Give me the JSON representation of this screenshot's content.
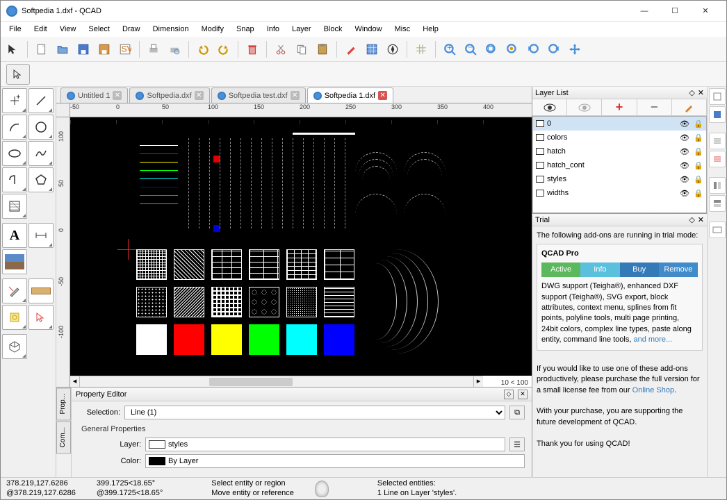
{
  "title": "Softpedia 1.dxf - QCAD",
  "window_buttons": {
    "minimize": "—",
    "maximize": "☐",
    "close": "✕"
  },
  "menu": [
    "File",
    "Edit",
    "View",
    "Select",
    "Draw",
    "Dimension",
    "Modify",
    "Snap",
    "Info",
    "Layer",
    "Block",
    "Window",
    "Misc",
    "Help"
  ],
  "tabs": [
    {
      "label": "Untitled 1",
      "active": false,
      "close": "gray"
    },
    {
      "label": "Softpedia.dxf",
      "active": false,
      "close": "gray"
    },
    {
      "label": "Softpedia test.dxf",
      "active": false,
      "close": "gray"
    },
    {
      "label": "Softpedia 1.dxf",
      "active": true,
      "close": "red"
    }
  ],
  "ruler_h": [
    "-50",
    "0",
    "50",
    "100",
    "150",
    "200",
    "250",
    "300",
    "350",
    "400"
  ],
  "ruler_v": [
    "100",
    "50",
    "0",
    "-50",
    "-100"
  ],
  "scroll_info": "10 < 100",
  "layer_panel": {
    "title": "Layer List",
    "layers": [
      {
        "name": "0",
        "selected": true
      },
      {
        "name": "colors",
        "selected": false
      },
      {
        "name": "hatch",
        "selected": false
      },
      {
        "name": "hatch_cont",
        "selected": false
      },
      {
        "name": "styles",
        "selected": false
      },
      {
        "name": "widths",
        "selected": false
      }
    ]
  },
  "trial": {
    "title": "Trial",
    "intro": "The following add-ons are running in trial mode:",
    "addon_name": "QCAD Pro",
    "btns": {
      "active": "Active",
      "info": "Info",
      "buy": "Buy",
      "remove": "Remove"
    },
    "desc": "DWG support (Teigha®), enhanced DXF support (Teigha®), SVG export, block attributes, context menu, splines from fit points, polyline tools, multi page printing, 24bit colors, complex line types, paste along entity, command line tools, ",
    "more": "and more...",
    "msg1a": "If you would like to use one of these add-ons productively, please purchase the full version for a small license fee from our ",
    "msg1b": "Online Shop",
    "msg1c": ".",
    "msg2": "With your purchase, you are supporting the future development of QCAD.",
    "msg3": "Thank you for using QCAD!"
  },
  "property_editor": {
    "title": "Property Editor",
    "selection_label": "Selection:",
    "selection_value": "Line (1)",
    "section": "General Properties",
    "layer_label": "Layer:",
    "layer_value": "styles",
    "color_label": "Color:",
    "color_value": "By Layer"
  },
  "vtabs": [
    "Prop...",
    "Com..."
  ],
  "status": {
    "coord1": "378.219,127.6286",
    "coord2": "@378.219,127.6286",
    "polar1": "399.1725<18.65°",
    "polar2": "@399.1725<18.65°",
    "hint1": "Select entity or region",
    "hint2": "Move entity or reference",
    "sel1": "Selected entities:",
    "sel2": "1 Line on Layer 'styles'."
  },
  "colors": {
    "red": "#ff0000",
    "yellow": "#ffff00",
    "green": "#00ff00",
    "cyan": "#00ffff",
    "blue": "#0000ff",
    "white": "#ffffff"
  }
}
